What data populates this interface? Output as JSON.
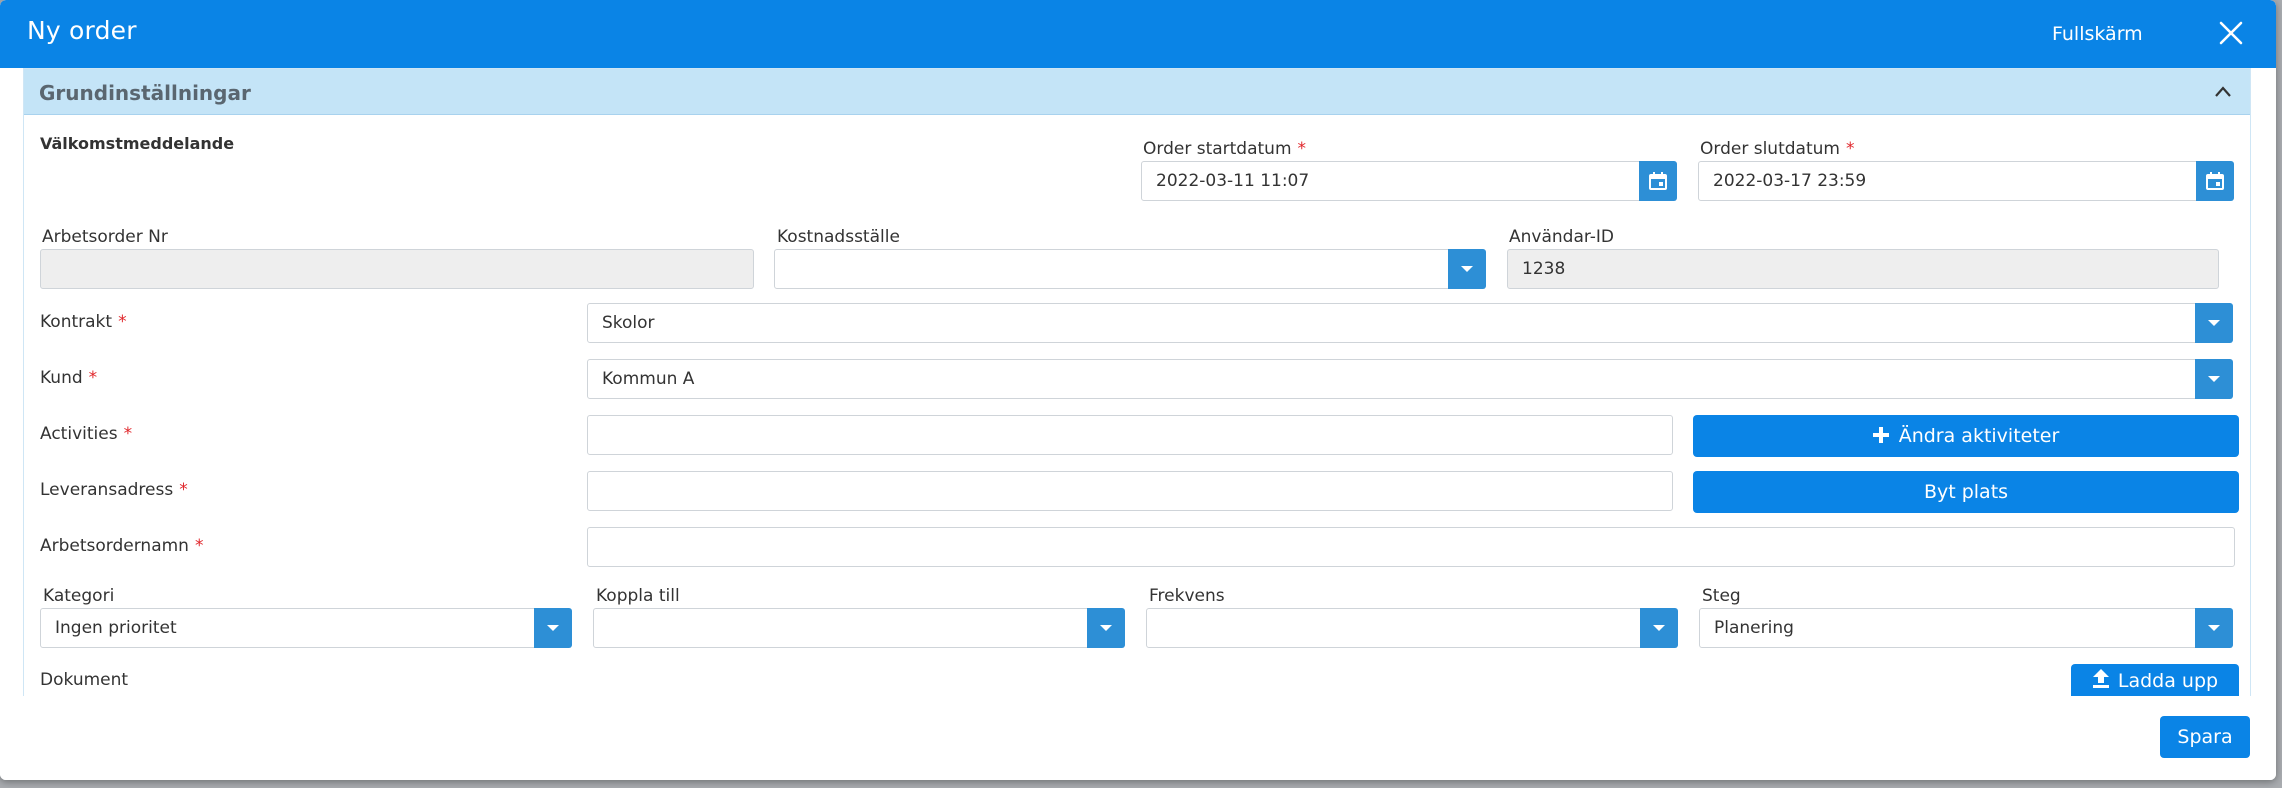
{
  "window": {
    "title": "Ny order",
    "fullscreen_label": "Fullskärm"
  },
  "panel": {
    "title": "Grundinställningar"
  },
  "welcome_label": "Välkomstmeddelande",
  "order_start": {
    "label": "Order startdatum",
    "value": "2022-03-11 11:07"
  },
  "order_end": {
    "label": "Order slutdatum",
    "value": "2022-03-17 23:59"
  },
  "work_order_nr": {
    "label": "Arbetsorder Nr",
    "value": ""
  },
  "cost_center": {
    "label": "Kostnadsställe",
    "value": ""
  },
  "user_id": {
    "label": "Användar-ID",
    "value": "1238"
  },
  "contract": {
    "label": "Kontrakt",
    "value": "Skolor"
  },
  "customer": {
    "label": "Kund",
    "value": "Kommun A"
  },
  "activities": {
    "label": "Activities",
    "value": "",
    "button": "Ändra aktiviteter"
  },
  "delivery_address": {
    "label": "Leveransadress",
    "value": "",
    "button": "Byt plats"
  },
  "work_order_name": {
    "label": "Arbetsordernamn",
    "value": ""
  },
  "category": {
    "label": "Kategori",
    "value": "Ingen prioritet"
  },
  "connect_to": {
    "label": "Koppla till",
    "value": ""
  },
  "frequency": {
    "label": "Frekvens",
    "value": ""
  },
  "step": {
    "label": "Steg",
    "value": "Planering"
  },
  "documents": {
    "label": "Dokument",
    "upload_button": "Ladda upp"
  },
  "required_marker": "*",
  "footer": {
    "save_label": "Spara"
  },
  "colors": {
    "header_blue": "#0a84e6",
    "panel_header": "#c4e4f7",
    "dropdown_button": "#2d8fd6",
    "required": "#e0262b"
  }
}
